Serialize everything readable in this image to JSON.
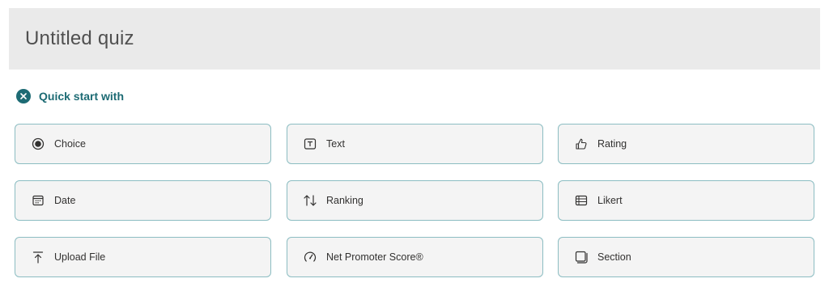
{
  "quiz": {
    "title": "Untitled quiz"
  },
  "quick_start": {
    "label": "Quick start with",
    "icon": "close-circle-icon",
    "accent_color": "#1d6b74"
  },
  "question_types": [
    {
      "label": "Choice",
      "icon": "radio-icon"
    },
    {
      "label": "Text",
      "icon": "text-box-icon"
    },
    {
      "label": "Rating",
      "icon": "thumbs-up-icon"
    },
    {
      "label": "Date",
      "icon": "calendar-icon"
    },
    {
      "label": "Ranking",
      "icon": "ranking-arrows-icon"
    },
    {
      "label": "Likert",
      "icon": "likert-grid-icon"
    },
    {
      "label": "Upload File",
      "icon": "upload-icon"
    },
    {
      "label": "Net Promoter Score®",
      "icon": "gauge-icon"
    },
    {
      "label": "Section",
      "icon": "section-icon"
    }
  ]
}
